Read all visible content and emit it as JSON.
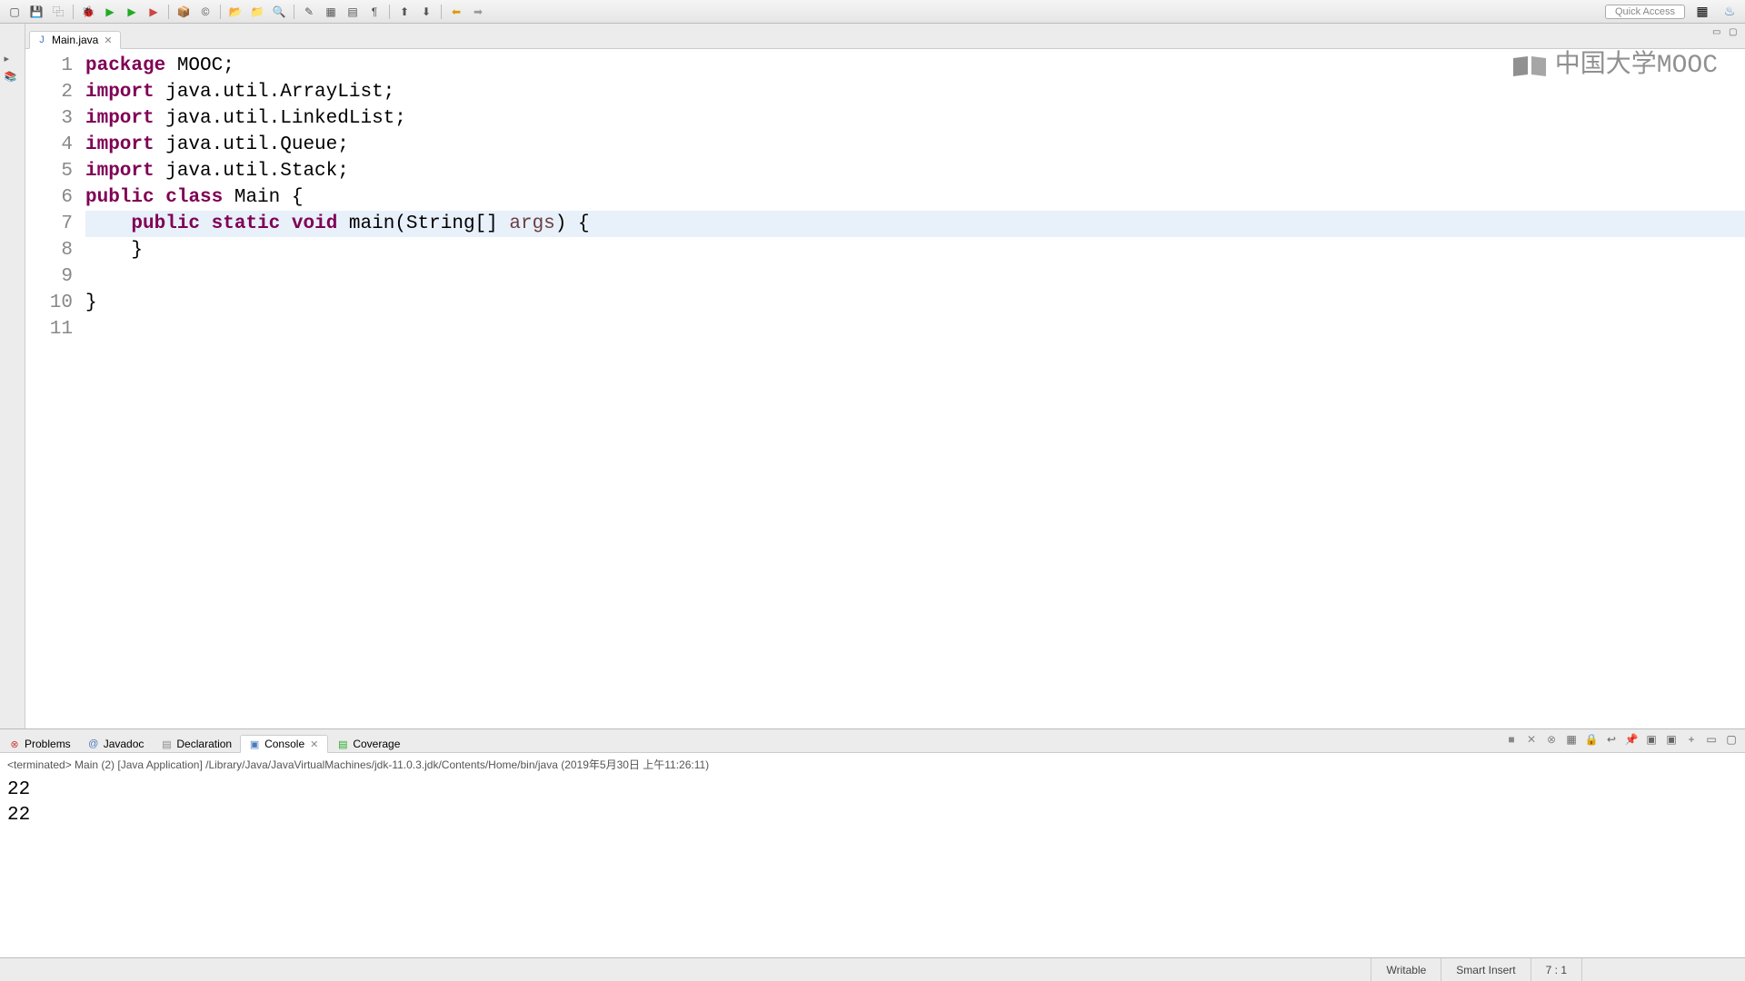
{
  "toolbar": {
    "quick_access": "Quick Access"
  },
  "tab": {
    "label": "Main.java"
  },
  "code": {
    "lines": [
      {
        "num": "1",
        "marker": "warn"
      },
      {
        "num": "2",
        "marker": "warn"
      },
      {
        "num": "3",
        "marker": "warn"
      },
      {
        "num": "4",
        "marker": "warn"
      },
      {
        "num": "5",
        "marker": "warn"
      },
      {
        "num": "6",
        "marker": ""
      },
      {
        "num": "7",
        "marker": "method"
      },
      {
        "num": "8",
        "marker": ""
      },
      {
        "num": "9",
        "marker": ""
      },
      {
        "num": "10",
        "marker": ""
      },
      {
        "num": "11",
        "marker": ""
      }
    ],
    "l1_kw": "package",
    "l1_rest": " MOOC;",
    "l2_kw": "import",
    "l2_rest": " java.util.ArrayList;",
    "l3_kw": "import",
    "l3_rest": " java.util.LinkedList;",
    "l4_kw": "import",
    "l4_rest": " java.util.Queue;",
    "l5_kw": "import",
    "l5_rest": " java.util.Stack;",
    "l6_kw1": "public",
    "l6_kw2": "class",
    "l6_rest": " Main {",
    "l7_pre": "    ",
    "l7_kw1": "public",
    "l7_kw2": "static",
    "l7_kw3": "void",
    "l7_method": " main",
    "l7_paren": "(String[] ",
    "l7_param": "args",
    "l7_end": ") {",
    "l8": "    }",
    "l9": "",
    "l10": "}",
    "l11": ""
  },
  "watermark": "中国大学MOOC",
  "bottom_tabs": {
    "problems": "Problems",
    "javadoc": "Javadoc",
    "declaration": "Declaration",
    "console": "Console",
    "coverage": "Coverage"
  },
  "console": {
    "terminated": "<terminated> Main (2) [Java Application] /Library/Java/JavaVirtualMachines/jdk-11.0.3.jdk/Contents/Home/bin/java (2019年5月30日 上午11:26:11)",
    "out1": "22",
    "out2": "22"
  },
  "status": {
    "writable": "Writable",
    "insert": "Smart Insert",
    "pos": "7 : 1"
  }
}
